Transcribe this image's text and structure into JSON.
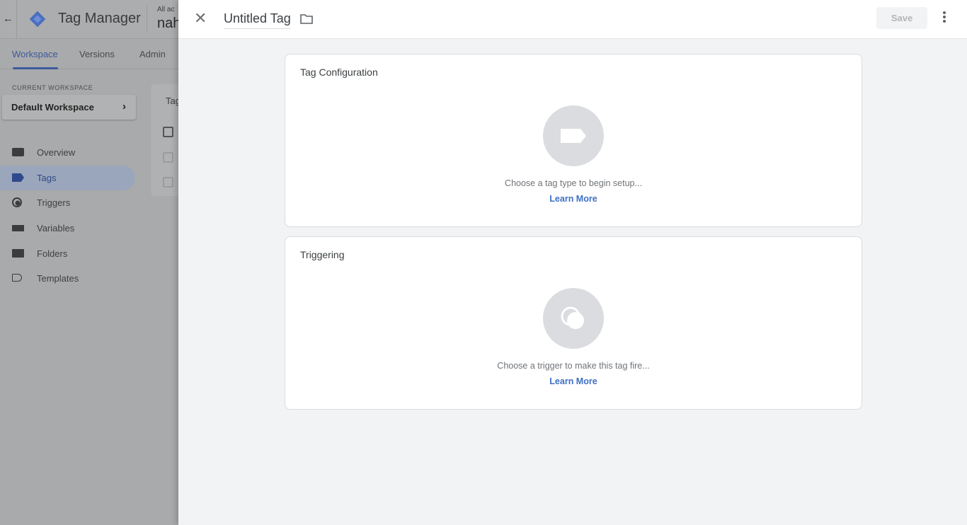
{
  "background": {
    "app_name": "Tag Manager",
    "account_label_partial": "All ac",
    "account_name_partial": "nah",
    "tabs": [
      {
        "label": "Workspace",
        "active": true
      },
      {
        "label": "Versions"
      },
      {
        "label": "Admin"
      }
    ],
    "current_workspace_label": "CURRENT WORKSPACE",
    "workspace_name": "Default Workspace",
    "nav": [
      {
        "label": "Overview",
        "icon": "overview-icon"
      },
      {
        "label": "Tags",
        "icon": "tag-icon",
        "active": true
      },
      {
        "label": "Triggers",
        "icon": "trigger-icon"
      },
      {
        "label": "Variables",
        "icon": "variables-icon"
      },
      {
        "label": "Folders",
        "icon": "folder-icon"
      },
      {
        "label": "Templates",
        "icon": "template-icon"
      }
    ],
    "card_title_partial": "Tag"
  },
  "panel": {
    "title": "Untitled Tag",
    "save_label": "Save",
    "tag_config": {
      "heading": "Tag Configuration",
      "hint": "Choose a tag type to begin setup...",
      "link": "Learn More"
    },
    "triggering": {
      "heading": "Triggering",
      "hint": "Choose a trigger to make this tag fire...",
      "link": "Learn More"
    }
  },
  "colors": {
    "accent": "#4285f4",
    "link": "#3f6fc4"
  }
}
